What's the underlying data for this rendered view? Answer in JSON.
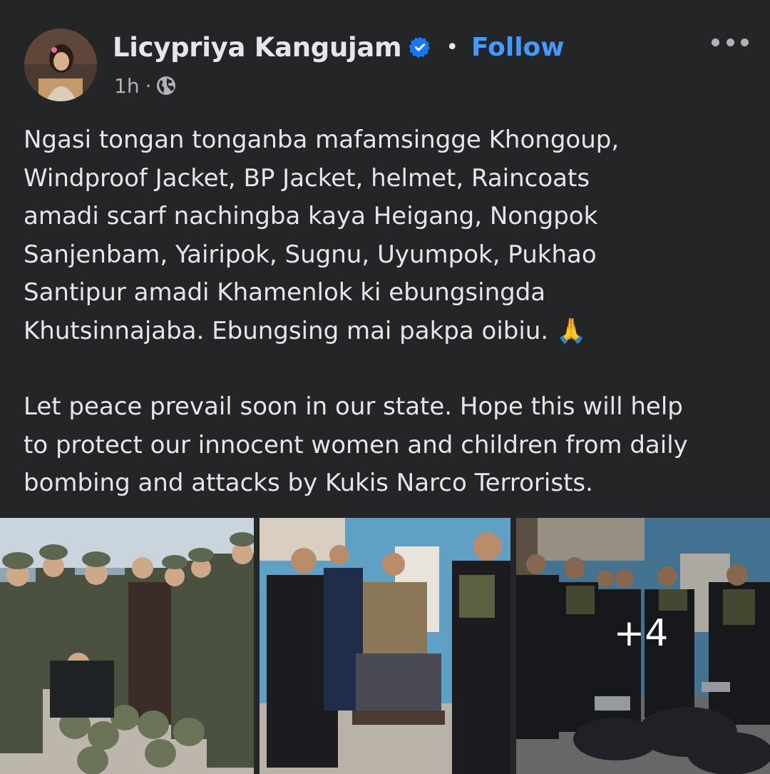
{
  "post": {
    "author": {
      "name": "Licypriya Kangujam",
      "verified": true,
      "avatar_icon": "profile-photo"
    },
    "separator": "•",
    "follow_label": "Follow",
    "timestamp": "1h",
    "meta_separator": "·",
    "audience_icon": "globe-icon",
    "more_icon": "more-options-icon",
    "paragraphs": [
      "Ngasi tongan tonganba mafamsingge Khongoup,\nWindproof Jacket,  BP Jacket,  helmet, Raincoats\namadi scarf nachingba kaya Heigang, Nongpok\nSanjenbam,  Yairipok, Sugnu,  Uyumpok,  Pukhao\nSantipur amadi Khamenlok ki ebungsingda\nKhutsinnajaba. Ebungsing mai pakpa oibiu. ",
      "Let peace prevail soon in our state. Hope this will help\nto protect our innocent women and children from daily\nbombing and attacks by Kukis Narco Terrorists."
    ],
    "emoji": "🙏",
    "photos": {
      "count_visible": 3,
      "more_count_label": "+4"
    }
  },
  "colors": {
    "background": "#242526",
    "text_primary": "#e4e6eb",
    "text_secondary": "#b0b3b8",
    "link_blue": "#4599ff",
    "verified_blue": "#1877f2"
  }
}
